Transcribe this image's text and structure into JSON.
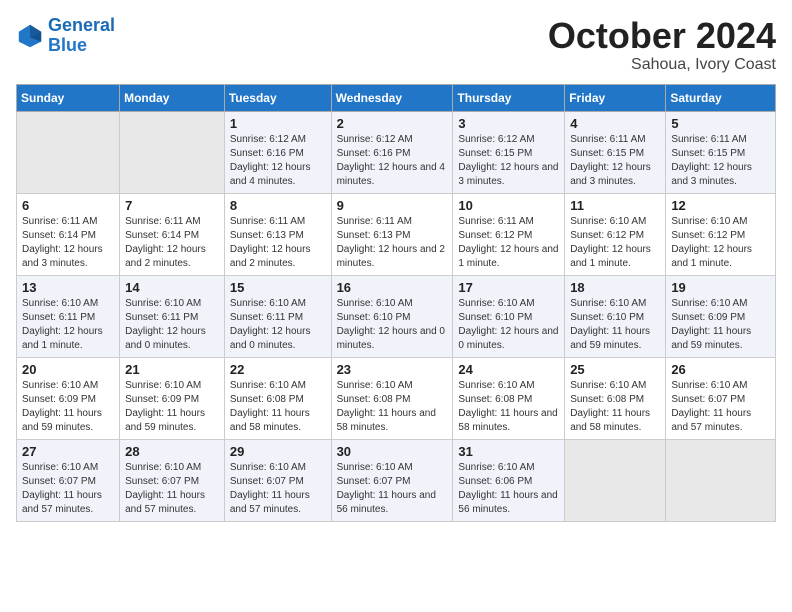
{
  "header": {
    "logo_line1": "General",
    "logo_line2": "Blue",
    "title": "October 2024",
    "subtitle": "Sahoua, Ivory Coast"
  },
  "days_of_week": [
    "Sunday",
    "Monday",
    "Tuesday",
    "Wednesday",
    "Thursday",
    "Friday",
    "Saturday"
  ],
  "weeks": [
    [
      {
        "day": "",
        "info": ""
      },
      {
        "day": "",
        "info": ""
      },
      {
        "day": "1",
        "info": "Sunrise: 6:12 AM\nSunset: 6:16 PM\nDaylight: 12 hours\nand 4 minutes."
      },
      {
        "day": "2",
        "info": "Sunrise: 6:12 AM\nSunset: 6:16 PM\nDaylight: 12 hours\nand 4 minutes."
      },
      {
        "day": "3",
        "info": "Sunrise: 6:12 AM\nSunset: 6:15 PM\nDaylight: 12 hours\nand 3 minutes."
      },
      {
        "day": "4",
        "info": "Sunrise: 6:11 AM\nSunset: 6:15 PM\nDaylight: 12 hours\nand 3 minutes."
      },
      {
        "day": "5",
        "info": "Sunrise: 6:11 AM\nSunset: 6:15 PM\nDaylight: 12 hours\nand 3 minutes."
      }
    ],
    [
      {
        "day": "6",
        "info": "Sunrise: 6:11 AM\nSunset: 6:14 PM\nDaylight: 12 hours\nand 3 minutes."
      },
      {
        "day": "7",
        "info": "Sunrise: 6:11 AM\nSunset: 6:14 PM\nDaylight: 12 hours\nand 2 minutes."
      },
      {
        "day": "8",
        "info": "Sunrise: 6:11 AM\nSunset: 6:13 PM\nDaylight: 12 hours\nand 2 minutes."
      },
      {
        "day": "9",
        "info": "Sunrise: 6:11 AM\nSunset: 6:13 PM\nDaylight: 12 hours\nand 2 minutes."
      },
      {
        "day": "10",
        "info": "Sunrise: 6:11 AM\nSunset: 6:12 PM\nDaylight: 12 hours\nand 1 minute."
      },
      {
        "day": "11",
        "info": "Sunrise: 6:10 AM\nSunset: 6:12 PM\nDaylight: 12 hours\nand 1 minute."
      },
      {
        "day": "12",
        "info": "Sunrise: 6:10 AM\nSunset: 6:12 PM\nDaylight: 12 hours\nand 1 minute."
      }
    ],
    [
      {
        "day": "13",
        "info": "Sunrise: 6:10 AM\nSunset: 6:11 PM\nDaylight: 12 hours\nand 1 minute."
      },
      {
        "day": "14",
        "info": "Sunrise: 6:10 AM\nSunset: 6:11 PM\nDaylight: 12 hours\nand 0 minutes."
      },
      {
        "day": "15",
        "info": "Sunrise: 6:10 AM\nSunset: 6:11 PM\nDaylight: 12 hours\nand 0 minutes."
      },
      {
        "day": "16",
        "info": "Sunrise: 6:10 AM\nSunset: 6:10 PM\nDaylight: 12 hours\nand 0 minutes."
      },
      {
        "day": "17",
        "info": "Sunrise: 6:10 AM\nSunset: 6:10 PM\nDaylight: 12 hours\nand 0 minutes."
      },
      {
        "day": "18",
        "info": "Sunrise: 6:10 AM\nSunset: 6:10 PM\nDaylight: 11 hours\nand 59 minutes."
      },
      {
        "day": "19",
        "info": "Sunrise: 6:10 AM\nSunset: 6:09 PM\nDaylight: 11 hours\nand 59 minutes."
      }
    ],
    [
      {
        "day": "20",
        "info": "Sunrise: 6:10 AM\nSunset: 6:09 PM\nDaylight: 11 hours\nand 59 minutes."
      },
      {
        "day": "21",
        "info": "Sunrise: 6:10 AM\nSunset: 6:09 PM\nDaylight: 11 hours\nand 59 minutes."
      },
      {
        "day": "22",
        "info": "Sunrise: 6:10 AM\nSunset: 6:08 PM\nDaylight: 11 hours\nand 58 minutes."
      },
      {
        "day": "23",
        "info": "Sunrise: 6:10 AM\nSunset: 6:08 PM\nDaylight: 11 hours\nand 58 minutes."
      },
      {
        "day": "24",
        "info": "Sunrise: 6:10 AM\nSunset: 6:08 PM\nDaylight: 11 hours\nand 58 minutes."
      },
      {
        "day": "25",
        "info": "Sunrise: 6:10 AM\nSunset: 6:08 PM\nDaylight: 11 hours\nand 58 minutes."
      },
      {
        "day": "26",
        "info": "Sunrise: 6:10 AM\nSunset: 6:07 PM\nDaylight: 11 hours\nand 57 minutes."
      }
    ],
    [
      {
        "day": "27",
        "info": "Sunrise: 6:10 AM\nSunset: 6:07 PM\nDaylight: 11 hours\nand 57 minutes."
      },
      {
        "day": "28",
        "info": "Sunrise: 6:10 AM\nSunset: 6:07 PM\nDaylight: 11 hours\nand 57 minutes."
      },
      {
        "day": "29",
        "info": "Sunrise: 6:10 AM\nSunset: 6:07 PM\nDaylight: 11 hours\nand 57 minutes."
      },
      {
        "day": "30",
        "info": "Sunrise: 6:10 AM\nSunset: 6:07 PM\nDaylight: 11 hours\nand 56 minutes."
      },
      {
        "day": "31",
        "info": "Sunrise: 6:10 AM\nSunset: 6:06 PM\nDaylight: 11 hours\nand 56 minutes."
      },
      {
        "day": "",
        "info": ""
      },
      {
        "day": "",
        "info": ""
      }
    ]
  ]
}
